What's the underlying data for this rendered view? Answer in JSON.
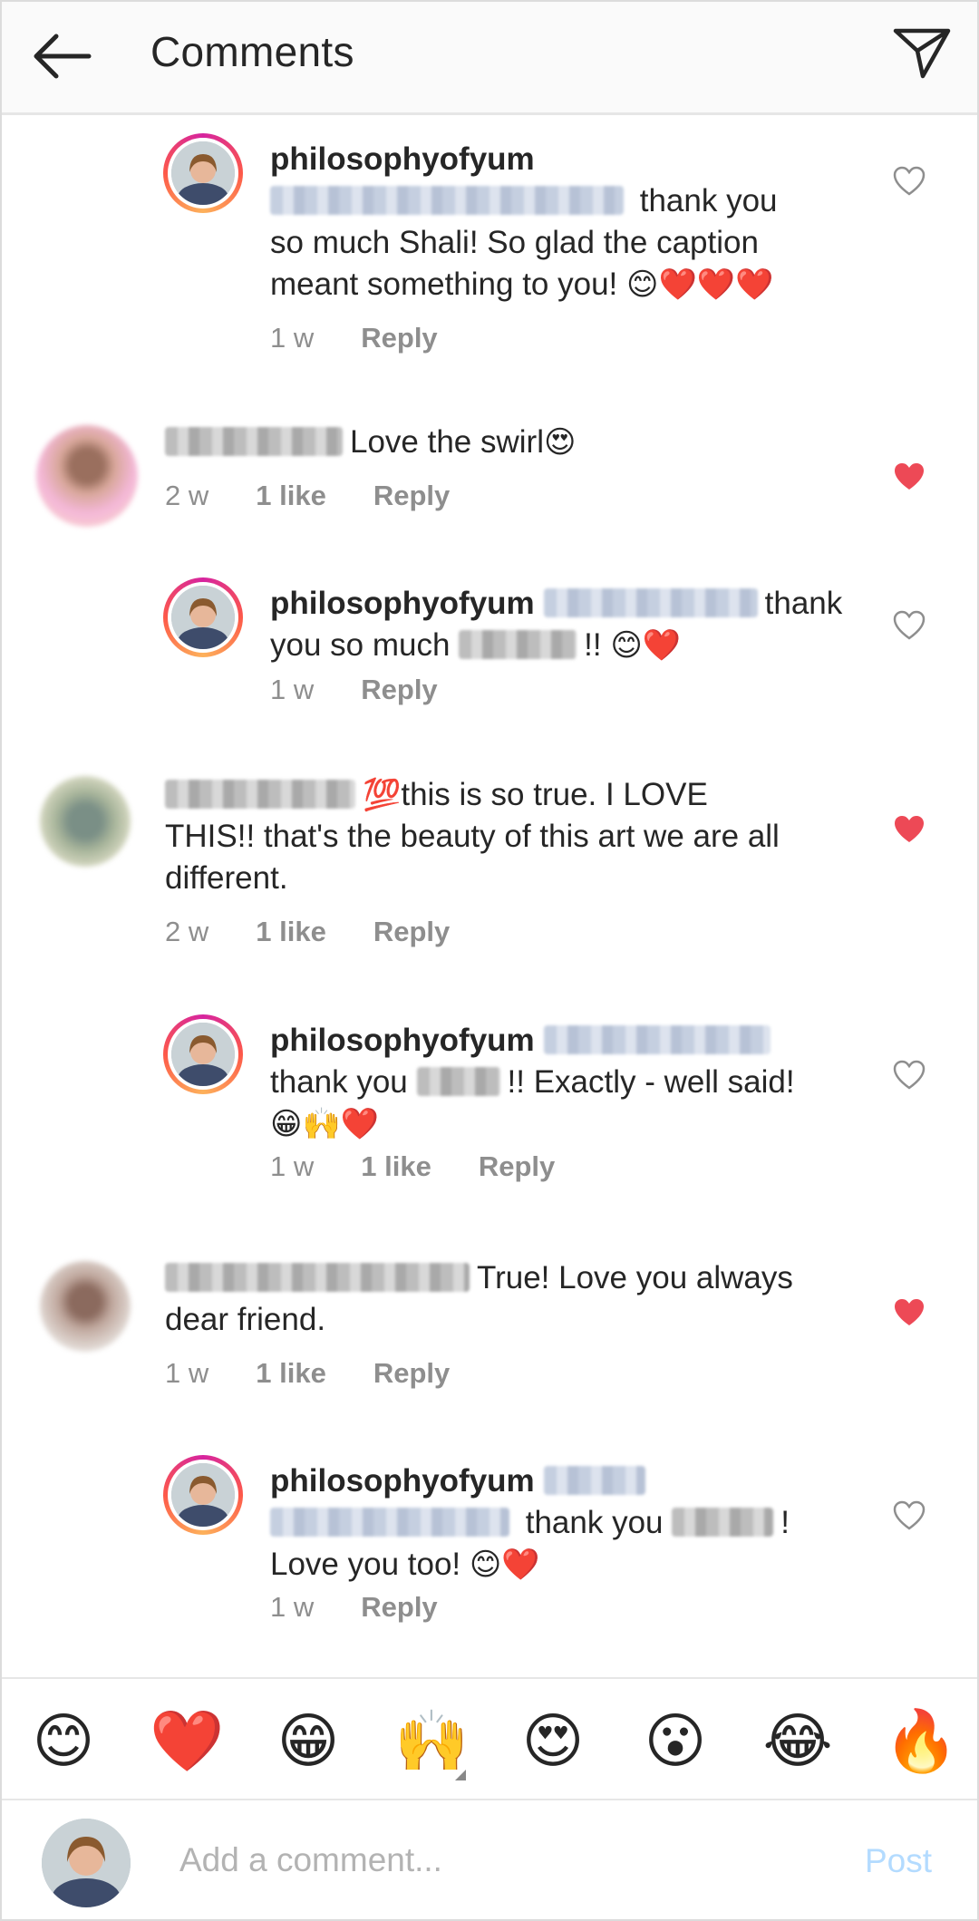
{
  "header": {
    "title": "Comments"
  },
  "comments": [
    {
      "username": "philosophyofyum",
      "text_a": "thank you",
      "text_b": "so much Shali! So glad the caption",
      "text_c": "meant something to you! ",
      "emoji": "😊❤️❤️❤️",
      "time": "1 w",
      "likes": "",
      "reply": "Reply",
      "liked": false
    },
    {
      "username": "",
      "text_a": "Love the swirl",
      "emoji": "😍",
      "time": "2 w",
      "likes": "1 like",
      "reply": "Reply",
      "liked": true
    },
    {
      "username": "philosophyofyum",
      "text_a": "thank",
      "text_b": "you so much",
      "text_c": "!! ",
      "emoji": "😊❤️",
      "time": "1 w",
      "likes": "",
      "reply": "Reply",
      "liked": false
    },
    {
      "username": "",
      "emoji": "💯",
      "text_a": "this is so true.  I LOVE",
      "text_b": "THIS!! that's the beauty of this art we are all",
      "text_c": "different.",
      "time": "2 w",
      "likes": "1 like",
      "reply": "Reply",
      "liked": true
    },
    {
      "username": "philosophyofyum",
      "text_a": "thank you",
      "text_b": "!! Exactly - well said!",
      "emoji": "😁🙌❤️",
      "time": "1 w",
      "likes": "1 like",
      "reply": "Reply",
      "liked": false
    },
    {
      "username": "",
      "text_a": "True! Love you always",
      "text_b": "dear friend.",
      "time": "1 w",
      "likes": "1 like",
      "reply": "Reply",
      "liked": true
    },
    {
      "username": "philosophyofyum",
      "text_a": "thank you",
      "text_b": "!",
      "text_c": "Love you too! ",
      "emoji": "😊❤️",
      "time": "1 w",
      "likes": "",
      "reply": "Reply",
      "liked": false
    }
  ],
  "emoji_bar": [
    "😊",
    "❤️",
    "😁",
    "🙌",
    "😍",
    "😮",
    "😂",
    "🔥"
  ],
  "composer": {
    "placeholder": "Add a comment...",
    "post_label": "Post"
  },
  "colors": {
    "like_red": "#ed4956",
    "post_disabled": "#b3dbff",
    "meta_gray": "#8e8e8e"
  }
}
